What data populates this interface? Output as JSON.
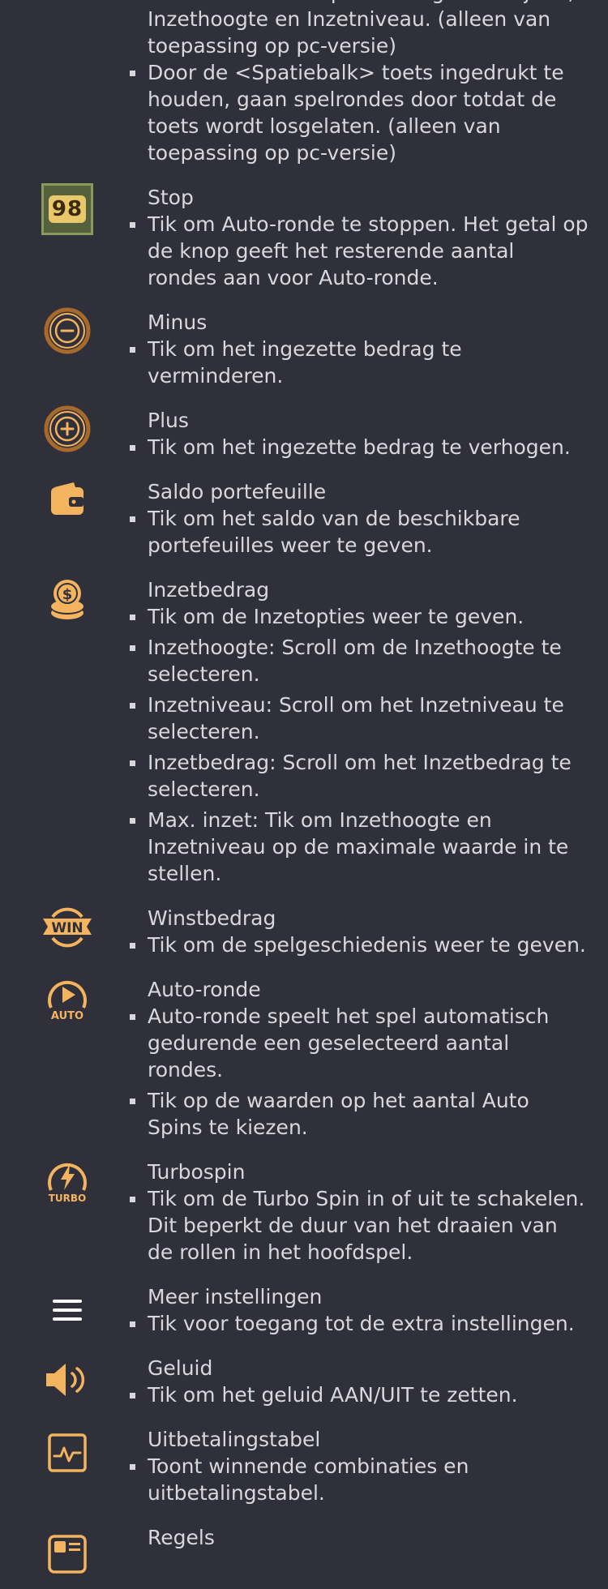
{
  "sections": {
    "space": {
      "items": [
        "ronde te starten op de huidige inzetlijnen, Inzethoogte en Inzetniveau. (alleen van toepassing op pc-versie)",
        "Door de <Spatiebalk> toets ingedrukt te houden, gaan spelrondes door totdat de toets wordt losgelaten. (alleen van toepassing op pc-versie)"
      ]
    },
    "stop": {
      "title": "Stop",
      "badge": "98",
      "items": [
        "Tik om Auto-ronde te stoppen. Het getal op de knop geeft het resterende aantal rondes aan voor Auto-ronde."
      ]
    },
    "minus": {
      "title": "Minus",
      "items": [
        "Tik om het ingezette bedrag te verminderen."
      ]
    },
    "plus": {
      "title": "Plus",
      "items": [
        "Tik om het ingezette bedrag te verhogen."
      ]
    },
    "wallet": {
      "title": "Saldo portefeuille",
      "items": [
        "Tik om het saldo van de beschikbare portefeuilles weer te geven."
      ]
    },
    "bet": {
      "title": "Inzetbedrag",
      "items": [
        "Tik om de Inzetopties weer te geven.",
        "Inzethoogte: Scroll om de Inzethoogte te selecteren.",
        "Inzetniveau: Scroll om het Inzetniveau te selecteren.",
        "Inzetbedrag: Scroll om het Inzetbedrag te selecteren.",
        "Max. inzet: Tik om Inzethoogte en Inzetniveau op de maximale waarde in te stellen."
      ]
    },
    "win": {
      "title": "Winstbedrag",
      "icon_label": "WIN",
      "items": [
        "Tik om de spelgeschiedenis weer te geven."
      ]
    },
    "auto": {
      "title": "Auto-ronde",
      "icon_label": "AUTO",
      "items": [
        "Auto-ronde speelt het spel automatisch gedurende een geselecteerd aantal rondes.",
        "Tik op de waarden op het aantal Auto Spins te kiezen."
      ]
    },
    "turbo": {
      "title": "Turbospin",
      "icon_label": "TURBO",
      "items": [
        "Tik om de Turbo Spin in of uit te schakelen. Dit beperkt de duur van het draaien van de rollen in het hoofdspel."
      ]
    },
    "menu": {
      "title": "Meer instellingen",
      "items": [
        "Tik voor toegang tot de extra instellingen."
      ]
    },
    "sound": {
      "title": "Geluid",
      "items": [
        "Tik om het geluid AAN/UIT te zetten."
      ]
    },
    "paytable": {
      "title": "Uitbetalingstabel",
      "items": [
        "Toont winnende combinaties en uitbetalingstabel."
      ]
    },
    "rules": {
      "title": "Regels"
    }
  },
  "colors": {
    "background": "#30303a",
    "text": "#d8d8dc",
    "accent": "#f4b35e",
    "accent_dark": "#a86a2a"
  },
  "icons": [
    "stop-badge-icon",
    "minus-icon",
    "plus-icon",
    "wallet-icon",
    "coins-icon",
    "win-icon",
    "auto-play-icon",
    "turbo-icon",
    "menu-icon",
    "sound-icon",
    "paytable-icon",
    "rules-icon"
  ]
}
